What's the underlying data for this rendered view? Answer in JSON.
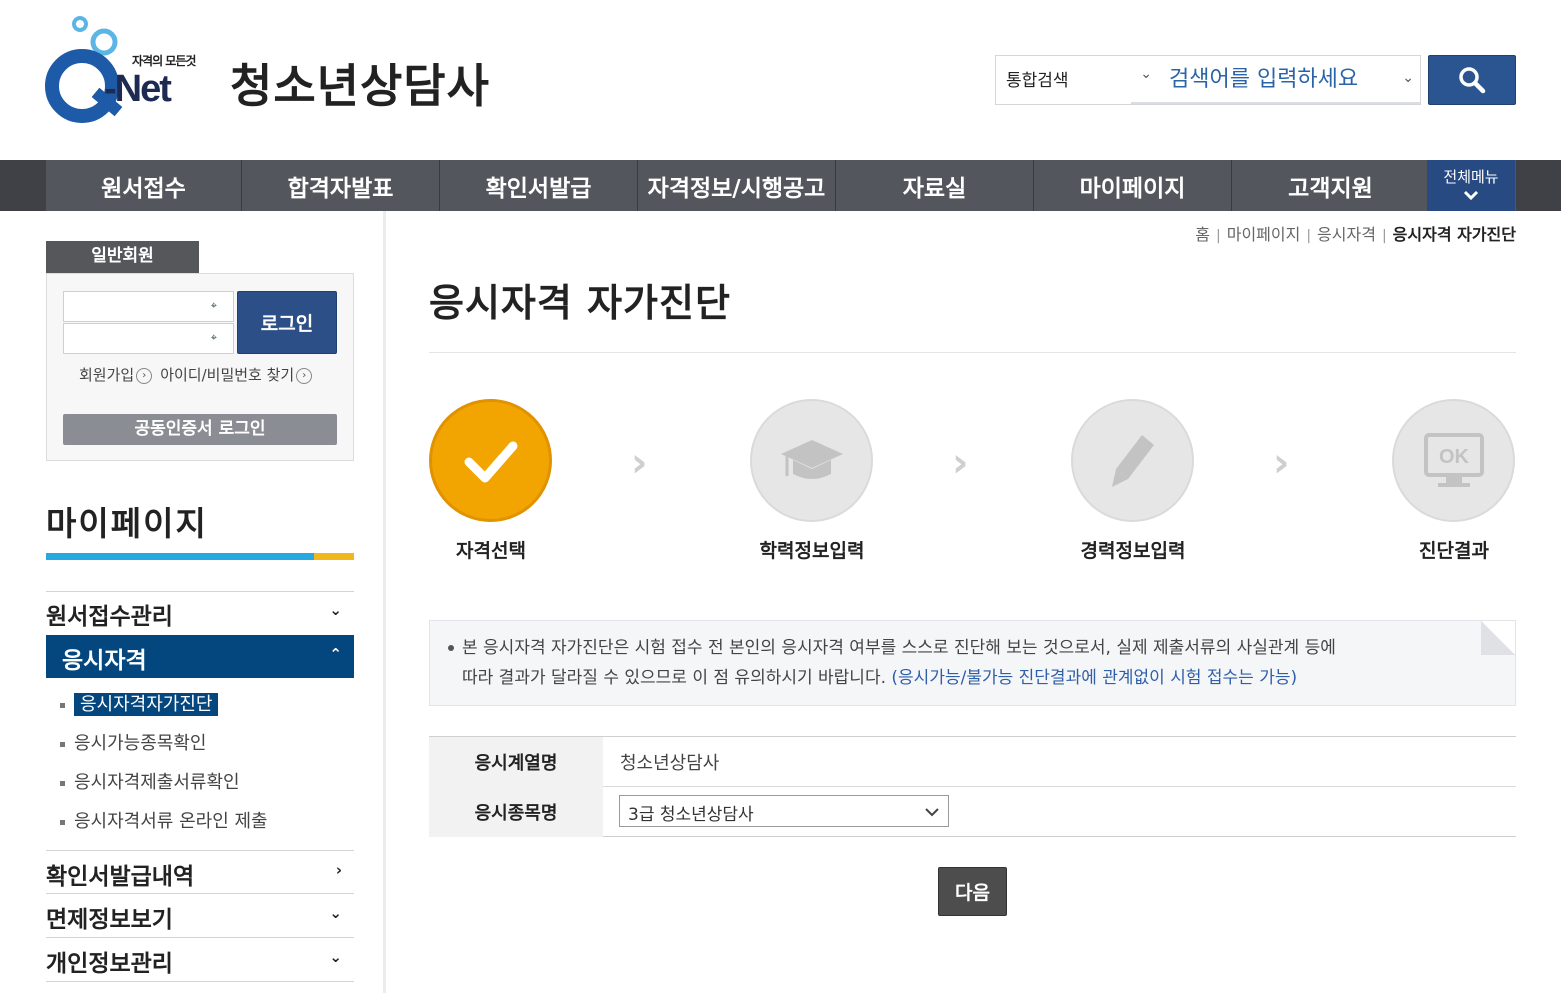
{
  "header": {
    "logo_tagline": "자격의 모든것",
    "logo_text": "-Net",
    "site_title": "청소년상담사",
    "search_category": "통합검색",
    "search_placeholder": "검색어를 입력하세요"
  },
  "nav": {
    "items": [
      "원서접수",
      "합격자발표",
      "확인서발급",
      "자격정보/시행공고",
      "자료실",
      "마이페이지",
      "고객지원"
    ],
    "all_menu": "전체메뉴"
  },
  "login": {
    "tab": "일반회원",
    "login_button": "로그인",
    "signup": "회원가입",
    "find_id": "아이디/비밀번호 찾기",
    "cert_login": "공동인증서 로그인"
  },
  "sidebar": {
    "title": "마이페이지",
    "menu1": "원서접수관리",
    "menu2": "응시자격",
    "sub": [
      "응시자격자가진단",
      "응시가능종목확인",
      "응시자격제출서류확인",
      "응시자격서류 온라인 제출"
    ],
    "menu3": "확인서발급내역",
    "menu4": "면제정보보기",
    "menu5": "개인정보관리"
  },
  "breadcrumb": {
    "home": "홈",
    "level1": "마이페이지",
    "level2": "응시자격",
    "current": "응시자격 자가진단"
  },
  "main": {
    "title": "응시자격 자가진단",
    "steps": [
      "자격선택",
      "학력정보입력",
      "경력정보입력",
      "진단결과"
    ],
    "step_ok_text": "OK",
    "notice_line1": "본 응시자격 자가진단은 시험 접수 전 본인의 응시자격 여부를 스스로 진단해 보는 것으로서, 실제 제출서류의 사실관계 등에",
    "notice_line2": "따라 결과가 달라질 수 있으므로 이 점 유의하시기 바랍니다.",
    "notice_blue": "(응시가능/불가능 진단결과에 관계없이 시험 접수는 가능)",
    "row1_label": "응시계열명",
    "row1_value": "청소년상담사",
    "row2_label": "응시종목명",
    "row2_value": "3급 청소년상담사",
    "next_button": "다음"
  },
  "colors": {
    "brand_blue": "#2b5590",
    "nav_bg": "#53565c",
    "active_menu": "#03477e",
    "step_active": "#f2a500"
  }
}
